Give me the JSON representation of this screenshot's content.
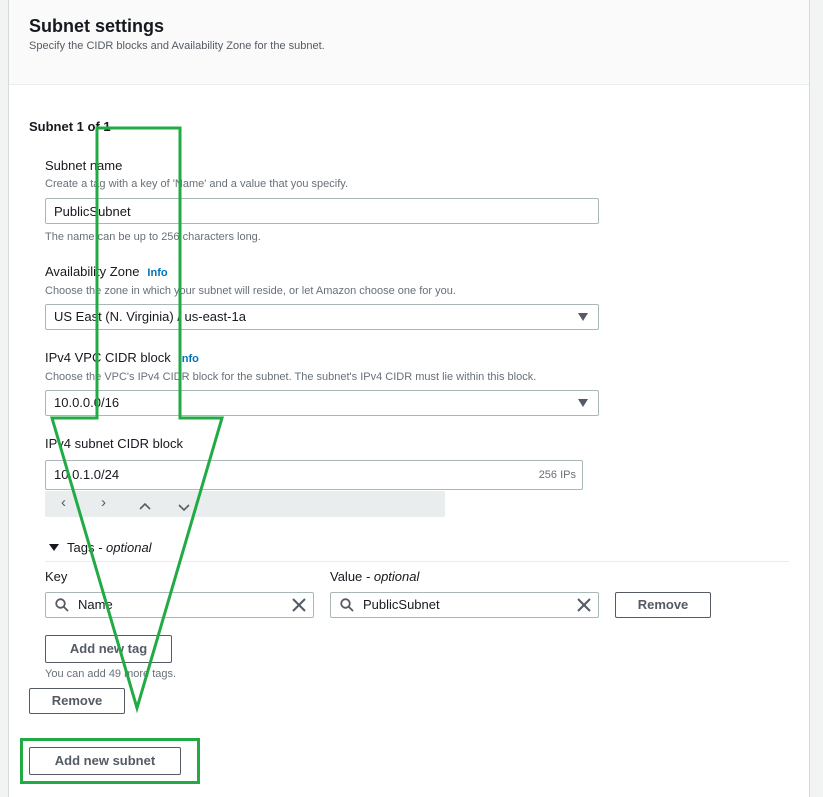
{
  "header": {
    "title": "Subnet settings",
    "subtitle": "Specify the CIDR blocks and Availability Zone for the subnet."
  },
  "subnet": {
    "heading": "Subnet 1 of 1",
    "name_label": "Subnet name",
    "name_desc": "Create a tag with a key of 'Name' and a value that you specify.",
    "name_value": "PublicSubnet",
    "name_hint": "The name can be up to 256 characters long.",
    "az_label": "Availability Zone",
    "az_info": "Info",
    "az_desc": "Choose the zone in which your subnet will reside, or let Amazon choose one for you.",
    "az_value": "US East (N. Virginia) / us-east-1a",
    "vpc_cidr_label": "IPv4 VPC CIDR block",
    "vpc_cidr_info": "Info",
    "vpc_cidr_desc": "Choose the VPC's IPv4 CIDR block for the subnet. The subnet's IPv4 CIDR must lie within this block.",
    "vpc_cidr_value": "10.0.0.0/16",
    "subnet_cidr_label": "IPv4 subnet CIDR block",
    "subnet_cidr_value": "10.0.1.0/24",
    "subnet_cidr_count": "256 IPs"
  },
  "tags": {
    "toggle_label": "Tags",
    "toggle_optional": " - optional",
    "key_label": "Key",
    "value_label": "Value",
    "value_optional": " - optional",
    "key_value": "Name",
    "value_value": "PublicSubnet",
    "remove_tag_label": "Remove",
    "add_tag_label": "Add new tag",
    "limit_hint": "You can add 49 more tags."
  },
  "actions": {
    "remove_subnet_label": "Remove",
    "add_subnet_label": "Add new subnet"
  },
  "annotation": {
    "color": "#22aa44"
  }
}
